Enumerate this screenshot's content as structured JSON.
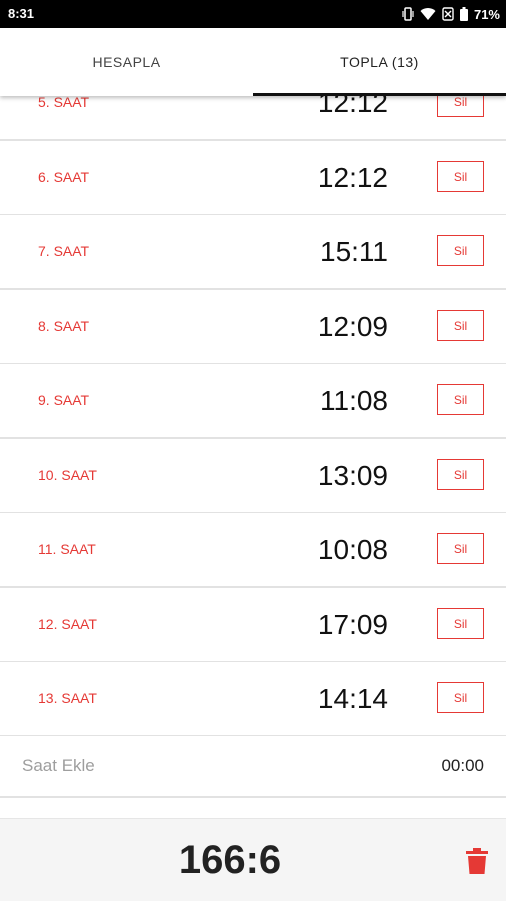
{
  "status_bar": {
    "time": "8:31",
    "battery_pct": "71%",
    "icons": [
      "vibrate-icon",
      "wifi-icon",
      "no-sim-icon",
      "battery-icon"
    ]
  },
  "tabs": [
    {
      "label": "HESAPLA",
      "active": false
    },
    {
      "label": "TOPLA (13)",
      "active": true
    }
  ],
  "rows": [
    {
      "label": "5. SAAT",
      "value": "12:12",
      "delete_label": "Sil"
    },
    {
      "label": "6. SAAT",
      "value": "12:12",
      "delete_label": "Sil"
    },
    {
      "label": "7. SAAT",
      "value": "15:11",
      "delete_label": "Sil"
    },
    {
      "label": "8. SAAT",
      "value": "12:09",
      "delete_label": "Sil"
    },
    {
      "label": "9. SAAT",
      "value": "11:08",
      "delete_label": "Sil"
    },
    {
      "label": "10. SAAT",
      "value": "13:09",
      "delete_label": "Sil"
    },
    {
      "label": "11. SAAT",
      "value": "10:08",
      "delete_label": "Sil"
    },
    {
      "label": "12. SAAT",
      "value": "17:09",
      "delete_label": "Sil"
    },
    {
      "label": "13. SAAT",
      "value": "14:14",
      "delete_label": "Sil"
    }
  ],
  "add_row": {
    "label": "Saat Ekle",
    "value": "00:00"
  },
  "footer": {
    "total": "166:6"
  },
  "colors": {
    "accent": "#e53935",
    "text": "#111111",
    "muted": "#9e9e9e"
  }
}
